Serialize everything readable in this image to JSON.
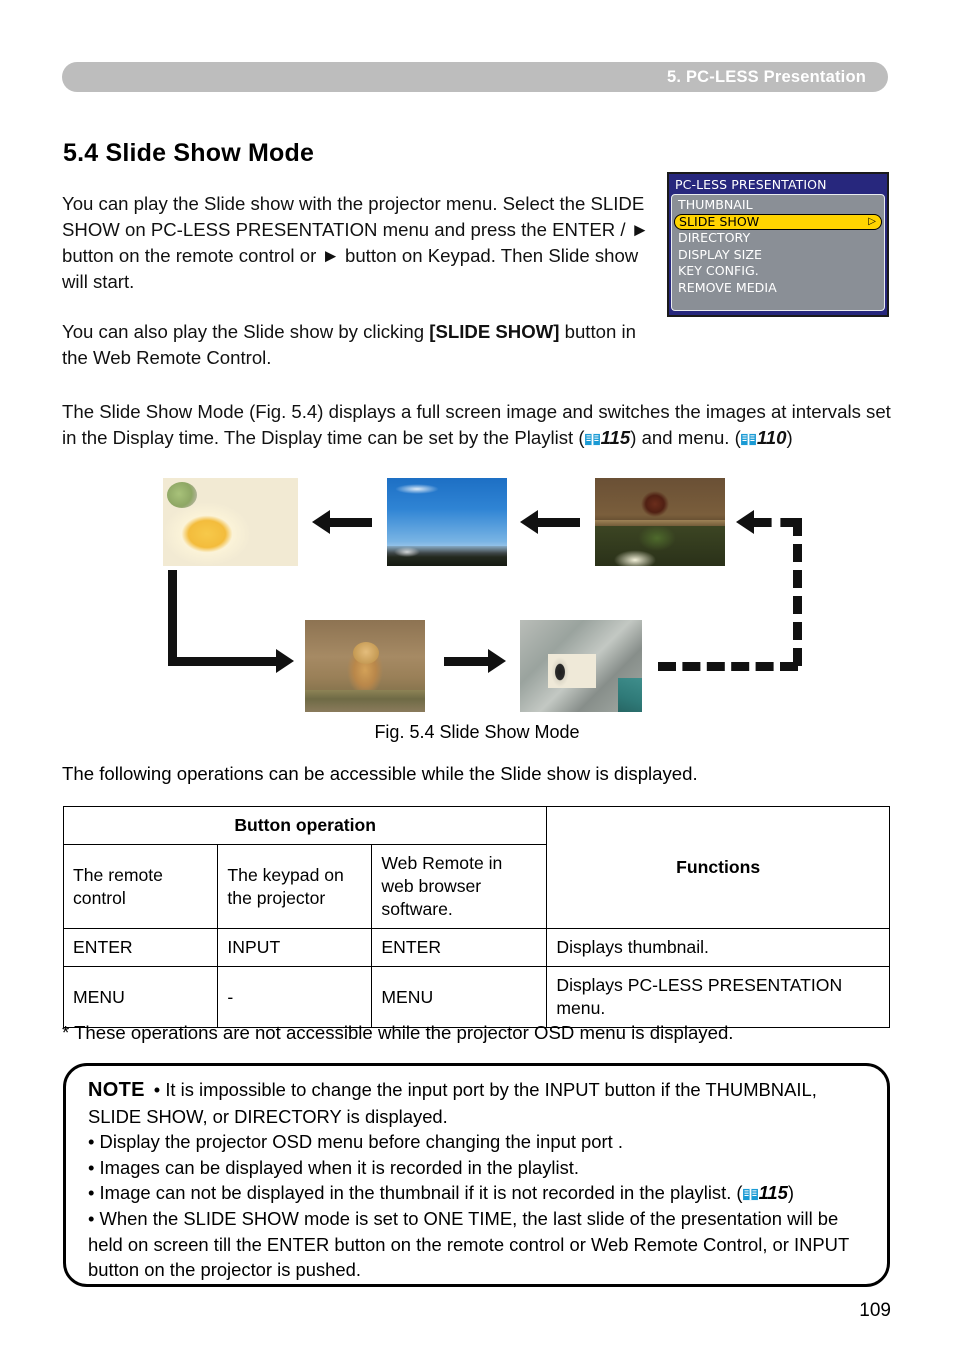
{
  "header": {
    "chapter_title": "5. PC-LESS Presentation",
    "bar_color": "#bdbdbd",
    "text_color": "#ffffff"
  },
  "section": {
    "title": "5.4 Slide Show Mode"
  },
  "paragraphs": {
    "p1": "You can play the Slide show with the projector menu. Select the SLIDE SHOW on PC-LESS PRESENTATION menu and press the ENTER / ► button on the remote control or ► button on Keypad. Then Slide show will start.",
    "p2_before": "You can also play the Slide show by clicking ",
    "p2_bold": "[SLIDE SHOW]",
    "p2_after": " button in the Web Remote Control.",
    "p3_a": "The Slide Show Mode (Fig. 5.4) displays a full screen image and switches the images at intervals set in the Display time. The Display time can be set by the Playlist (",
    "p3_ref1": "115",
    "p3_b": ") and menu. (",
    "p3_ref2": "110",
    "p3_c": ")"
  },
  "osd_menu": {
    "title": "PC-LESS PRESENTATION",
    "title_bg": "#27277d",
    "body_bg": "#8a8f96",
    "highlight_bg": "#ffd400",
    "selected": "SLIDE SHOW",
    "submenu_arrow": "▷",
    "items": [
      {
        "label": "THUMBNAIL",
        "selected": false
      },
      {
        "label": "SLIDE SHOW",
        "selected": true
      },
      {
        "label": "DIRECTORY",
        "selected": false
      },
      {
        "label": "DISPLAY SIZE",
        "selected": false
      },
      {
        "label": "KEY CONFIG.",
        "selected": false
      },
      {
        "label": "REMOVE MEDIA",
        "selected": false
      }
    ]
  },
  "figure": {
    "caption": "Fig. 5.4 Slide Show Mode",
    "photos": [
      {
        "name": "food-plates-photo",
        "alt": "plates of food with a mango dessert"
      },
      {
        "name": "blue-sky-mountains-photo",
        "alt": "blue sky over mountains and trees"
      },
      {
        "name": "red-panda-photo",
        "alt": "red panda in a zoo enclosure"
      },
      {
        "name": "lion-photo",
        "alt": "lion resting on a rocky slope"
      },
      {
        "name": "penguins-photo",
        "alt": "penguins standing on rocks"
      }
    ]
  },
  "lead_line": "The following operations can be accessible while the Slide show is displayed.",
  "table": {
    "group_header": "Button operation",
    "functions_header": "Functions",
    "columns": [
      "The remote control",
      "The keypad on the projector",
      "Web Remote in web browser software."
    ],
    "rows": [
      {
        "remote": "ENTER",
        "keypad": "INPUT",
        "web": "ENTER",
        "function": "Displays thumbnail."
      },
      {
        "remote": "MENU",
        "keypad": "-",
        "web": "MENU",
        "function": "Displays PC-LESS PRESENTATION menu."
      }
    ]
  },
  "asterisk_note": "* These operations are not accessible while the projector OSD menu is displayed.",
  "note": {
    "label": "NOTE",
    "line1": "• It is impossible to change the input port by the INPUT button if the THUMBNAIL, SLIDE SHOW, or DIRECTORY is displayed.",
    "line2": "• Display the projector OSD menu before changing the input port .",
    "line3": "• Images can be displayed when it is recorded in the playlist.",
    "line4_a": "• Image can not be displayed in the thumbnail if it is not recorded in the playlist. (",
    "line4_ref": "115",
    "line4_b": ")",
    "line5": "• When the SLIDE SHOW mode is set to ONE TIME, the last slide of the presentation will be held on screen till the ENTER button on the remote control or Web Remote Control, or INPUT button on the projector is pushed."
  },
  "page_number": "109"
}
